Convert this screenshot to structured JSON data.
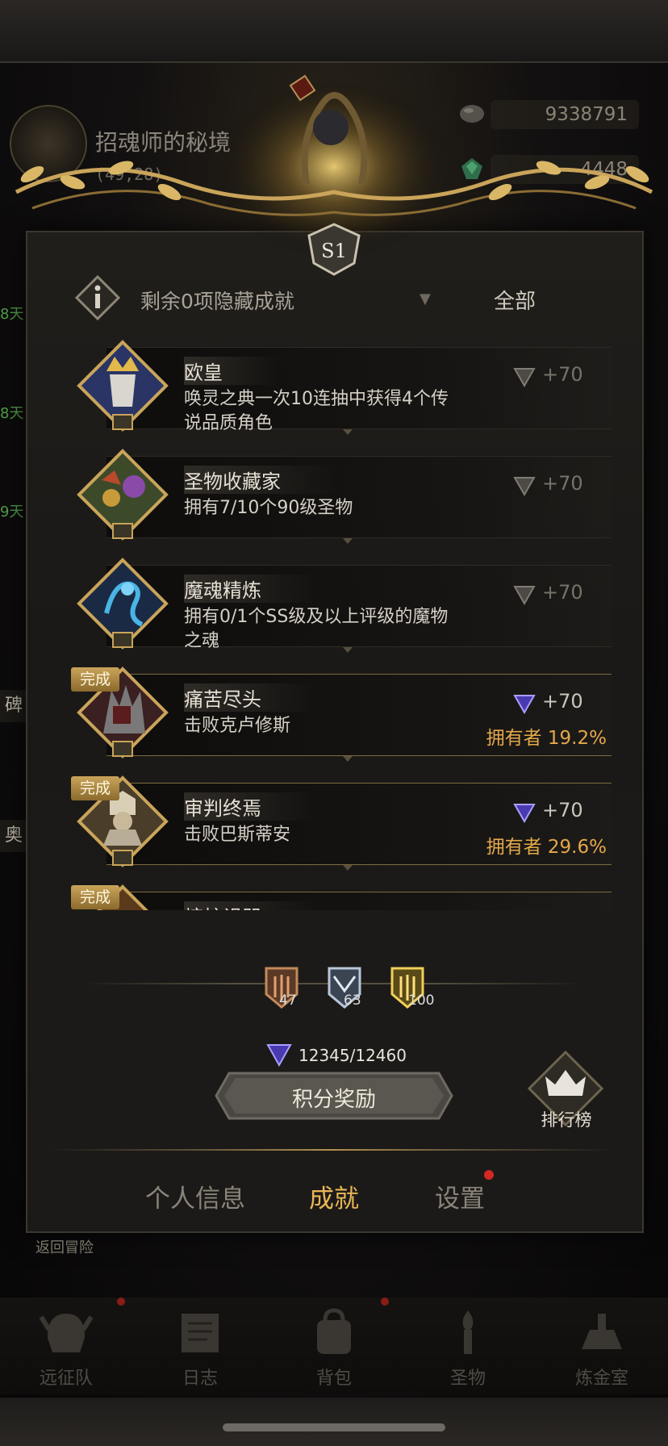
{
  "map": {
    "title": "招魂师的秘境",
    "coords": "(49,28)"
  },
  "resources": [
    {
      "icon": "stone-icon",
      "value": "9338791"
    },
    {
      "icon": "emerald-icon",
      "value": "4448"
    }
  ],
  "side": {
    "left_labels": [
      "8天",
      "8天",
      "9天"
    ],
    "tags": [
      "碑",
      "奥"
    ]
  },
  "season": {
    "badge": "S1"
  },
  "filter": {
    "hidden_text": "剩余0项隐藏成就",
    "dropdown": "全部"
  },
  "achievements": [
    {
      "title": "欧皇",
      "desc": "唤灵之典一次10连抽中获得4个传说品质角色",
      "points": "+70",
      "completed": false,
      "owners": "",
      "portrait": "crowned-king-portrait-icon"
    },
    {
      "title": "圣物收藏家",
      "desc": "拥有7/10个90级圣物",
      "points": "+70",
      "completed": false,
      "owners": "",
      "portrait": "relic-collection-portrait-icon"
    },
    {
      "title": "魔魂精炼",
      "desc": "拥有0/1个SS级及以上评级的魔物之魂",
      "points": "+70",
      "completed": false,
      "owners": "",
      "portrait": "blue-spirit-portrait-icon"
    },
    {
      "title": "痛苦尽头",
      "desc": "击败克卢修斯",
      "points": "+70",
      "completed": true,
      "done_label": "完成",
      "owners": "拥有者 19.2%",
      "portrait": "spiked-knight-portrait-icon"
    },
    {
      "title": "审判终焉",
      "desc": "击败巴斯蒂安",
      "points": "+70",
      "completed": true,
      "done_label": "完成",
      "owners": "拥有者 29.6%",
      "portrait": "judge-portrait-icon"
    },
    {
      "title": "熔炉诅咒",
      "desc": "",
      "points": "",
      "completed": true,
      "done_label": "完成",
      "owners": "",
      "portrait": "furnace-portrait-icon"
    }
  ],
  "medals": [
    {
      "tier": "bronze",
      "count": "47"
    },
    {
      "tier": "silver",
      "count": "63"
    },
    {
      "tier": "gold",
      "count": "100"
    }
  ],
  "total_points": "12345/12460",
  "buttons": {
    "reward": "积分奖励",
    "ranking": "排行榜",
    "back": "返回冒险"
  },
  "tabs": [
    "个人信息",
    "成就",
    "设置"
  ],
  "nav": [
    "远征队",
    "日志",
    "背包",
    "圣物",
    "炼金室"
  ],
  "colors": {
    "accent_gold": "#e8b656",
    "owner_orange": "#e4a84a",
    "alert_red": "#d22a22",
    "completed_tag": "#c9a45a"
  }
}
